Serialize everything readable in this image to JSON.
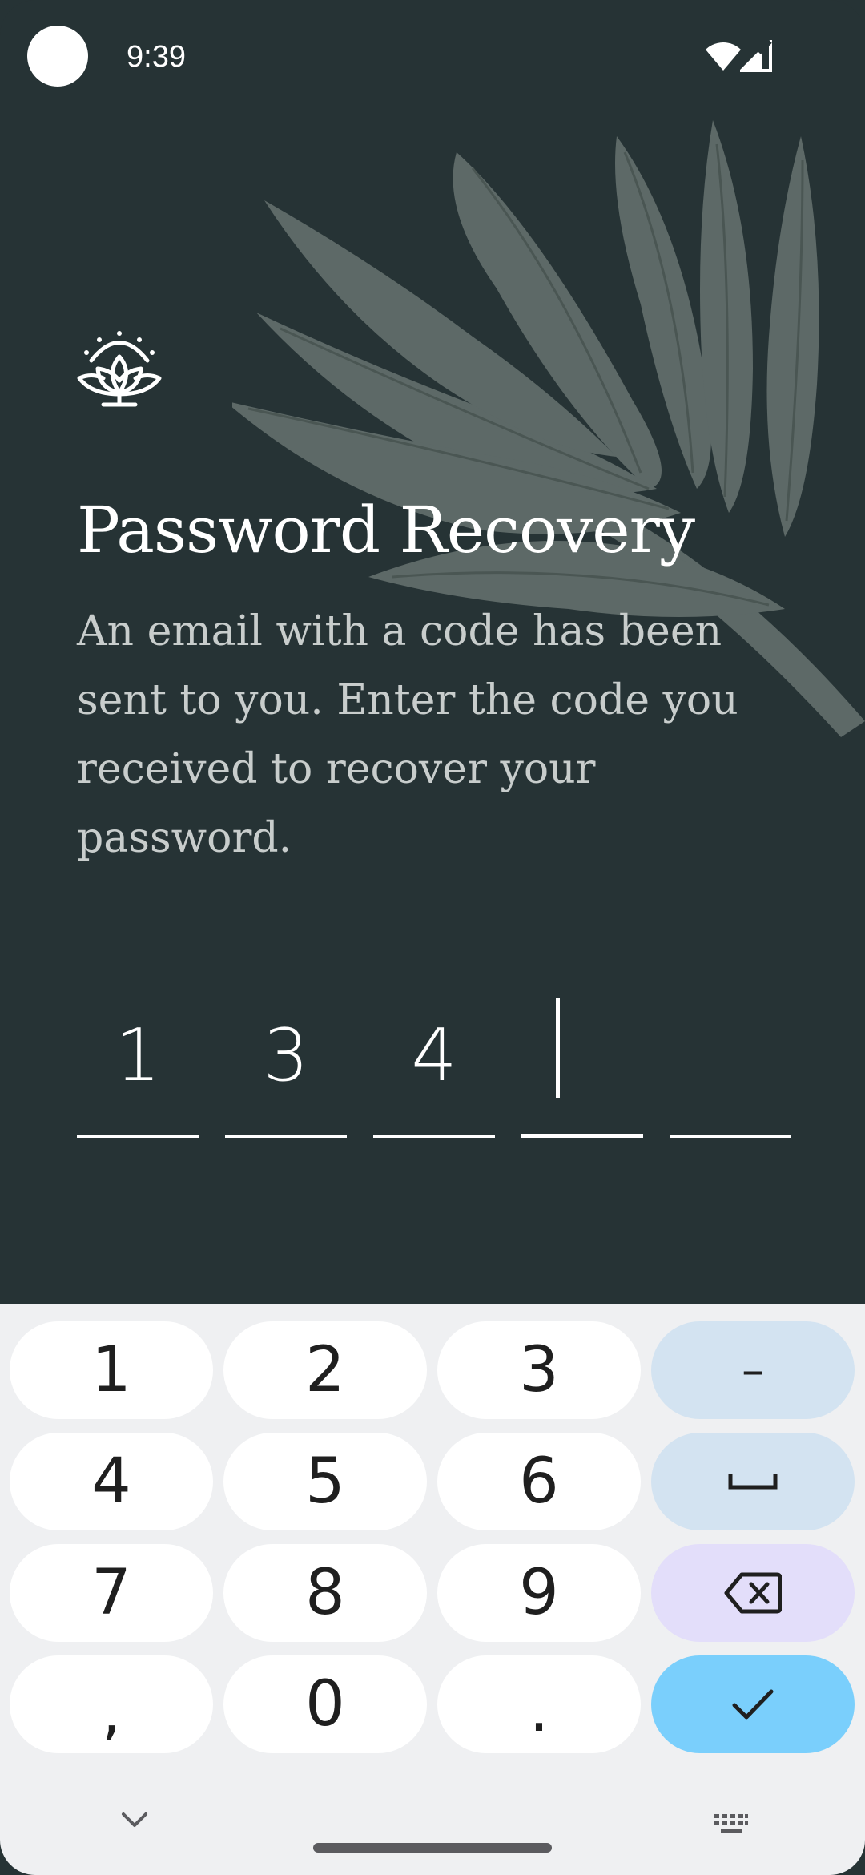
{
  "status_bar": {
    "time": "9:39"
  },
  "header": {
    "title": "Password Recovery",
    "subtitle": "An email with a code has been sent to you. Enter the code you received to recover your password."
  },
  "code_input": {
    "digits": [
      "1",
      "3",
      "4",
      "",
      ""
    ],
    "active_index": 3
  },
  "keyboard": {
    "keys": [
      {
        "label": "1"
      },
      {
        "label": "2"
      },
      {
        "label": "3"
      },
      {
        "label": "–"
      },
      {
        "label": "4"
      },
      {
        "label": "5"
      },
      {
        "label": "6"
      },
      {
        "label": "␣"
      },
      {
        "label": "7"
      },
      {
        "label": "8"
      },
      {
        "label": "9"
      },
      {
        "label": "⌫"
      },
      {
        "label": ","
      },
      {
        "label": "0"
      },
      {
        "label": "."
      },
      {
        "label": "✓"
      }
    ]
  },
  "colors": {
    "background": "#263335",
    "leaf": "#5d6967",
    "keyboard_bg": "#eff0f2",
    "func_key": "#d3e3f1",
    "delete_key": "#e3defa",
    "enter_key": "#7acffc"
  },
  "icons": [
    "camera-dot",
    "wifi-icon",
    "signal-icon",
    "lotus-logo-icon",
    "leaf-decoration",
    "backspace-icon",
    "checkmark-icon",
    "space-icon",
    "chevron-down-icon",
    "keyboard-icon"
  ]
}
